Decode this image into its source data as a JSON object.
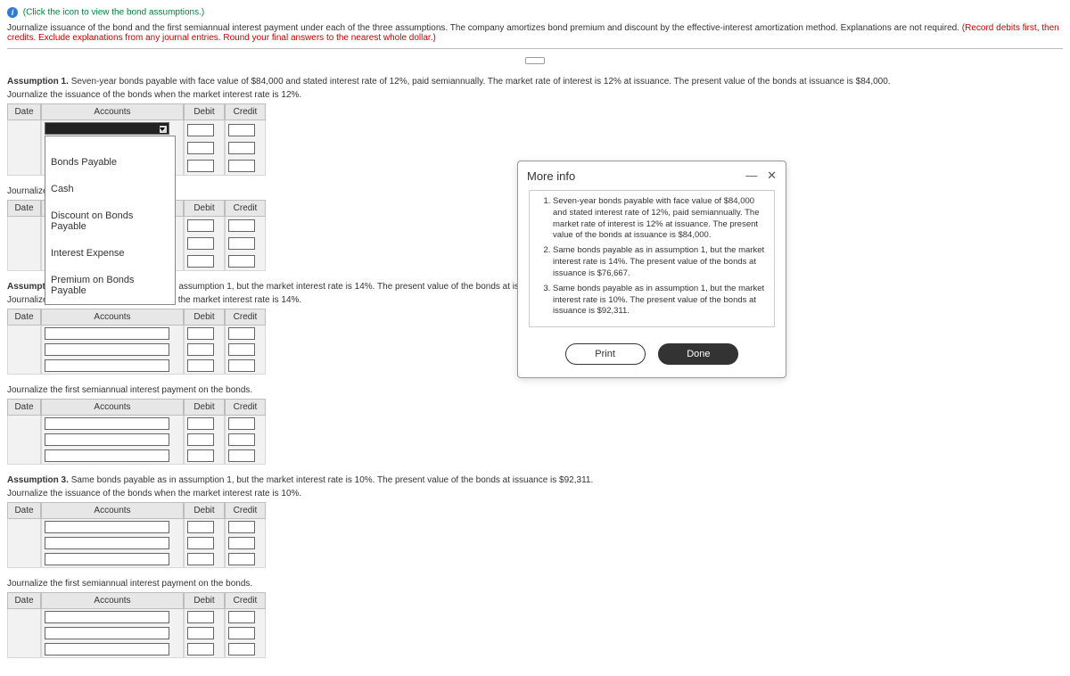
{
  "header": {
    "link": "(Click the icon to view the bond assumptions.)",
    "instruction_black": "Journalize issuance of the bond and the first semiannual interest payment under each of the three assumptions. The company amortizes bond premium and discount by the effective-interest amortization method. Explanations are not required. ",
    "instruction_red": "(Record debits first, then credits. Exclude explanations from any journal entries. Round your final answers to the nearest whole dollar.)"
  },
  "table_headers": {
    "date": "Date",
    "accounts": "Accounts",
    "debit": "Debit",
    "credit": "Credit"
  },
  "a1": {
    "title": "Assumption 1.",
    "text": " Seven-year bonds payable with face value of $84,000 and stated interest rate of 12%, paid semiannually. The market rate of interest is 12% at issuance. The present value of the bonds at issuance is $84,000.",
    "sub_a": "Journalize the issuance of the bonds when the market interest rate is 12%.",
    "sub_b": "Journalize"
  },
  "dropdown": {
    "opt1": "Bonds Payable",
    "opt2": "Cash",
    "opt3": "Discount on Bonds Payable",
    "opt4": "Interest Expense",
    "opt5": "Premium on Bonds Payable"
  },
  "a2": {
    "title": "Assumption 2.",
    "text": " Same bonds payable as in assumption 1, but the market interest rate is 14%. The present value of the bonds at issuance is $76,667.",
    "sub_a": "Journalize the issuance of the bonds when the market interest rate is 14%.",
    "sub_b": "Journalize the first semiannual interest payment on the bonds."
  },
  "a3": {
    "title": "Assumption 3.",
    "text": " Same bonds payable as in assumption 1, but the market interest rate is 10%. The present value of the bonds at issuance is $92,311.",
    "sub_a": "Journalize the issuance of the bonds when the market interest rate is 10%.",
    "sub_b": "Journalize the first semiannual interest payment on the bonds."
  },
  "modal": {
    "title": "More info",
    "item1": "Seven-year bonds payable with face value of $84,000 and stated interest rate of 12%, paid semiannually. The market rate of interest is 12% at issuance. The present value of the bonds at issuance is $84,000.",
    "item2": "Same bonds payable as in assumption 1, but the market interest rate is 14%. The present value of the bonds at issuance is $76,667.",
    "item3": "Same bonds payable as in assumption 1, but the market interest rate is 10%. The present value of the bonds at issuance is $92,311.",
    "print": "Print",
    "done": "Done"
  }
}
